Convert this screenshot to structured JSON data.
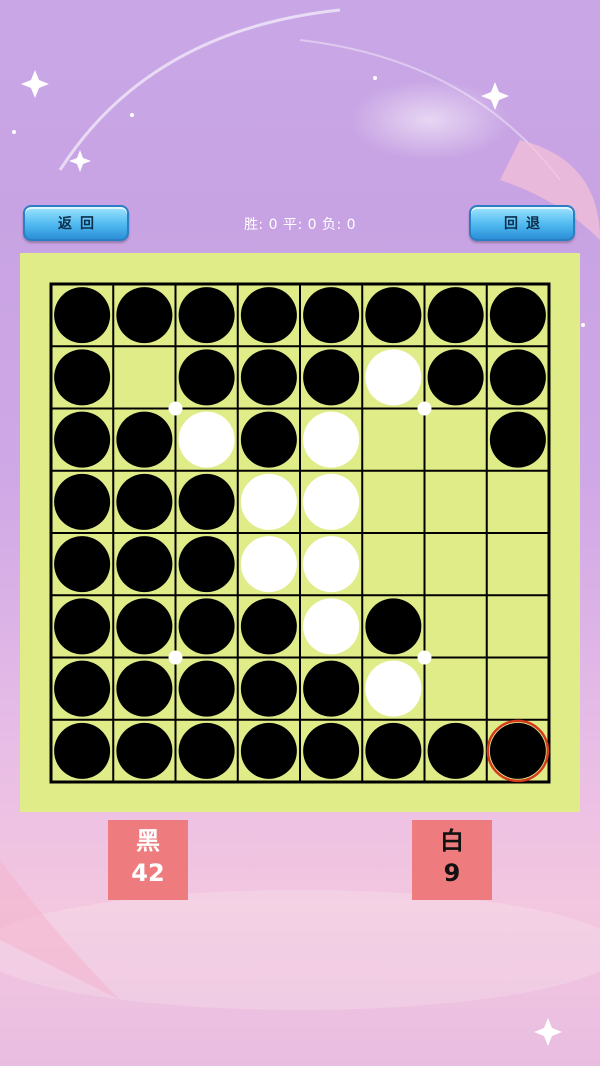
{
  "buttons": {
    "back_label": "返回",
    "undo_label": "回退"
  },
  "record": {
    "text": "胜: 0  平: 0  负: 0"
  },
  "players": {
    "black": {
      "label": "黑",
      "count": "42"
    },
    "white": {
      "label": "白",
      "count": "9"
    }
  },
  "colors": {
    "board": "#e0ec88",
    "grid": "#000000",
    "panel": "#ee7b7d",
    "last_move_ring": "#d43a1c"
  },
  "board": {
    "rows": [
      "BBBBBBBB",
      "B.BBBWBB",
      "BBWBW..B",
      "BBBWW...",
      "BBBWW...",
      "BBBBWB..",
      "BBBBBW..",
      "BBBBBBBB"
    ],
    "last_move": [
      7,
      7
    ]
  }
}
